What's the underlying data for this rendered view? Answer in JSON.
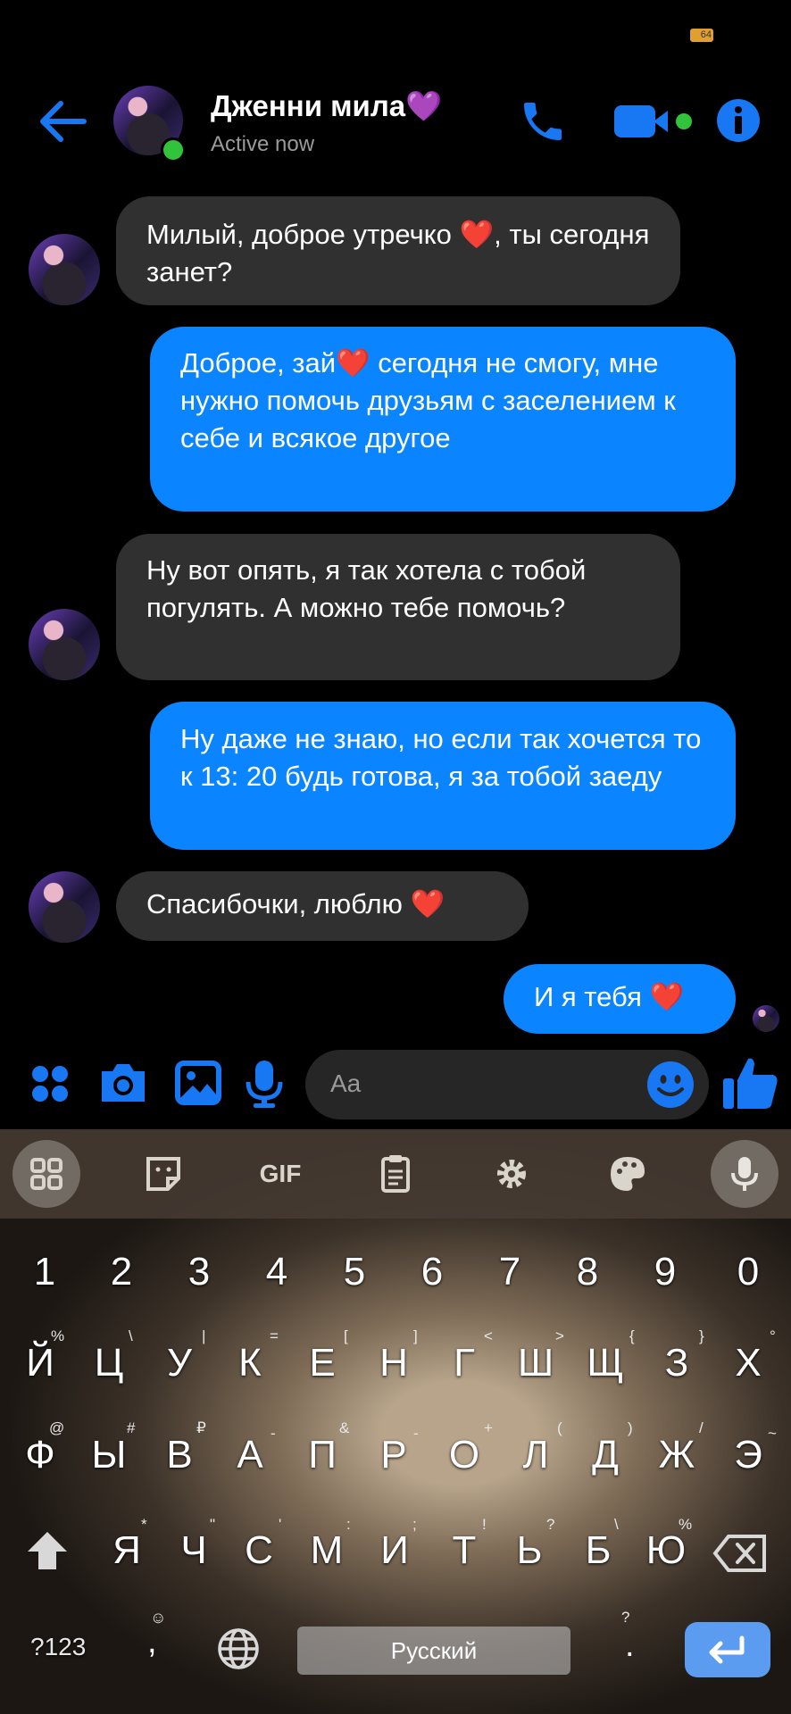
{
  "status_bar": {
    "battery": "64"
  },
  "header": {
    "contact_name": "Дженни мила💜",
    "status": "Active now",
    "icons": [
      "back-arrow-icon",
      "phone-icon",
      "video-camera-icon",
      "info-icon"
    ]
  },
  "messages": [
    {
      "side": "in",
      "text_a": "Милый, доброе утречко ",
      "heart": "❤️",
      "text_b": ", ты сегодня занет?"
    },
    {
      "side": "out",
      "text_a": "Доброе, зай",
      "heart": "❤️",
      "text_b": " сегодня не смогу, мне нужно помочь друзьям с заселением к себе и всякое другое"
    },
    {
      "side": "in",
      "text": "Ну вот опять, я так хотела с тобой погулять. А можно тебе помочь?"
    },
    {
      "side": "out",
      "text": "Ну даже не знаю, но если так хочется то к 13: 20 будь готова, я за тобой заеду"
    },
    {
      "side": "in",
      "text": "Спасибочки, люблю ",
      "heart": "❤️"
    },
    {
      "side": "out",
      "text": "И я тебя ",
      "heart": "❤️"
    }
  ],
  "composer": {
    "placeholder": "Aa",
    "icons": [
      "apps-icon",
      "camera-icon",
      "gallery-icon",
      "microphone-icon",
      "emoji-icon",
      "thumbs-up-icon"
    ]
  },
  "keyboard": {
    "toolbar": {
      "gif_label": "GIF"
    },
    "number_row": [
      "1",
      "2",
      "3",
      "4",
      "5",
      "6",
      "7",
      "8",
      "9",
      "0"
    ],
    "row1": [
      "Й",
      "Ц",
      "У",
      "К",
      "Е",
      "Н",
      "Г",
      "Ш",
      "Щ",
      "З",
      "Х"
    ],
    "row1_hints": [
      "%",
      "\\",
      "|",
      "=",
      "[",
      "]",
      "<",
      ">",
      "{",
      "}",
      "°"
    ],
    "row2": [
      "Ф",
      "Ы",
      "В",
      "А",
      "П",
      "Р",
      "О",
      "Л",
      "Д",
      "Ж",
      "Э"
    ],
    "row2_hints": [
      "@",
      "#",
      "₽",
      "-",
      "&",
      "-",
      "+",
      "(",
      ")",
      "/",
      "~"
    ],
    "row3": [
      "Я",
      "Ч",
      "С",
      "М",
      "И",
      "Т",
      "Ь",
      "Б",
      "Ю"
    ],
    "row3_hints": [
      "*",
      "\"",
      "'",
      ":",
      ";",
      "!",
      "?",
      "\\",
      "%"
    ],
    "symbols_label": "?123",
    "comma": ",",
    "comma_hint": "☺",
    "space_label": "Русский",
    "period": ".",
    "period_hint": "?"
  }
}
